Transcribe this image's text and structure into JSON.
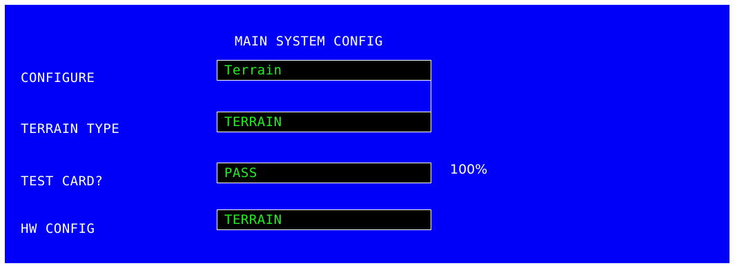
{
  "screen": {
    "title": "MAIN SYSTEM CONFIG",
    "background_color": "#0000f8",
    "field_text_color": "#22ee22"
  },
  "rows": [
    {
      "label": "CONFIGURE",
      "value": "Terrain"
    },
    {
      "label": "TERRAIN TYPE",
      "value": "TERRAIN"
    },
    {
      "label": "TEST CARD?",
      "value": "PASS",
      "progress_text": "100%"
    },
    {
      "label": "HW CONFIG",
      "value": "TERRAIN"
    }
  ]
}
